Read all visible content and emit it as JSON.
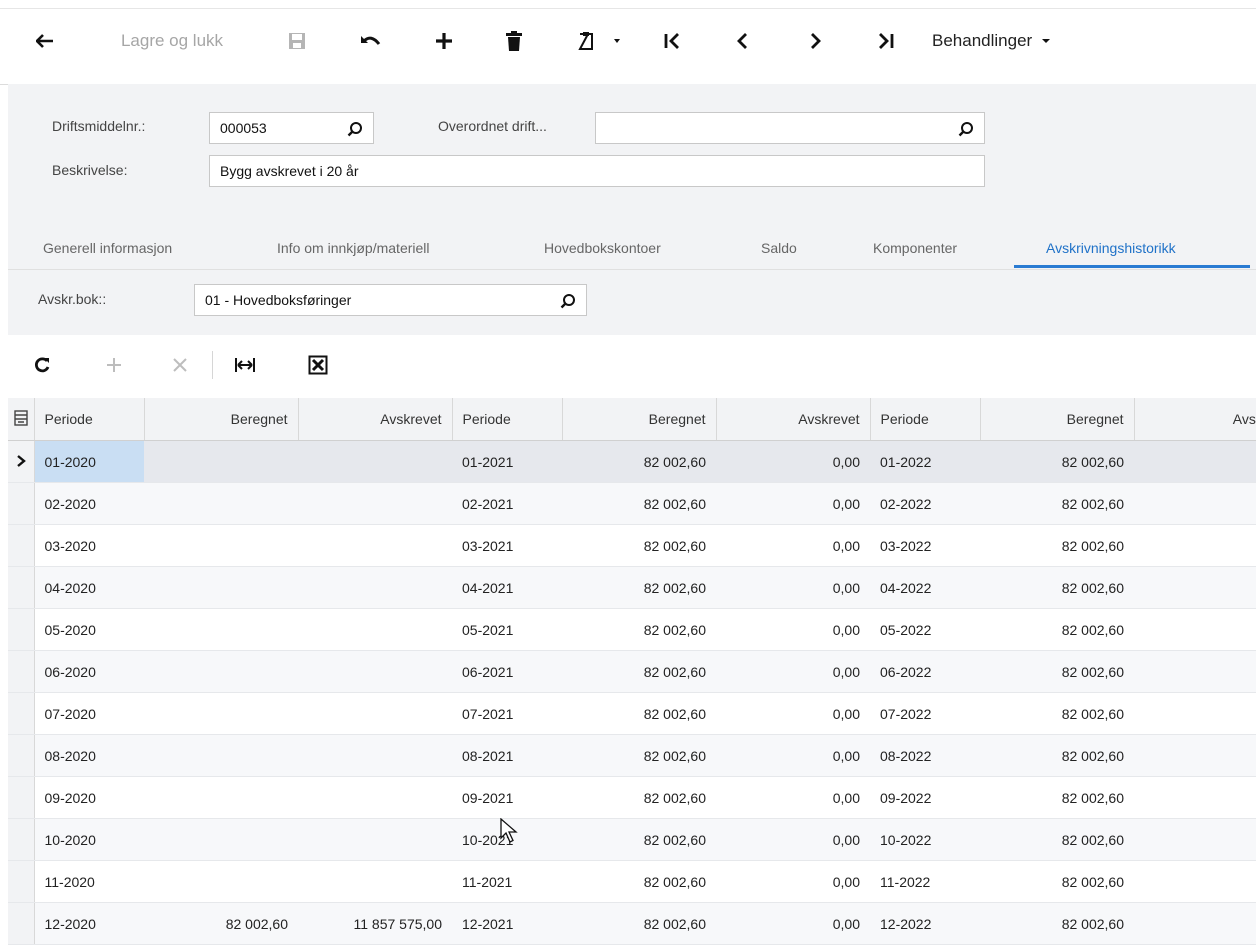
{
  "toolbar": {
    "back_icon": "arrow-left-icon",
    "save_close_label": "Lagre og lukk",
    "save_icon": "floppy-disk-icon",
    "undo_icon": "undo-icon",
    "add_icon": "plus-icon",
    "delete_icon": "trash-icon",
    "clipboard_icon": "clipboard-dropdown-icon",
    "first_icon": "first-record-icon",
    "prev_icon": "previous-record-icon",
    "next_icon": "next-record-icon",
    "last_icon": "last-record-icon",
    "actions_label": "Behandlinger"
  },
  "form": {
    "asset_no_label": "Driftsmiddelnr.:",
    "asset_no_value": "000053",
    "parent_label": "Overordnet drift...",
    "parent_value": "",
    "description_label": "Beskrivelse:",
    "description_value": "Bygg avskrevet i 20 år"
  },
  "tabs": [
    {
      "label": "Generell informasjon",
      "active": false
    },
    {
      "label": "Info om innkjøp/materiell",
      "active": false
    },
    {
      "label": "Hovedbokskontoer",
      "active": false
    },
    {
      "label": "Saldo",
      "active": false
    },
    {
      "label": "Komponenter",
      "active": false
    },
    {
      "label": "Avskrivningshistorikk",
      "active": true
    }
  ],
  "book": {
    "label": "Avskr.bok::",
    "value": "01 - Hovedboksføringer"
  },
  "grid_toolbar": {
    "refresh_icon": "refresh-icon",
    "add_icon": "plus-icon",
    "remove_icon": "close-icon",
    "fit_icon": "fit-columns-icon",
    "export_icon": "excel-export-icon"
  },
  "grid": {
    "columns": [
      "Periode",
      "Beregnet",
      "Avskrevet",
      "Periode",
      "Beregnet",
      "Avskrevet",
      "Periode",
      "Beregnet",
      "Avskr"
    ],
    "rows": [
      [
        "01-2020",
        "",
        "",
        "01-2021",
        "82 002,60",
        "0,00",
        "01-2022",
        "82 002,60",
        "("
      ],
      [
        "02-2020",
        "",
        "",
        "02-2021",
        "82 002,60",
        "0,00",
        "02-2022",
        "82 002,60",
        "("
      ],
      [
        "03-2020",
        "",
        "",
        "03-2021",
        "82 002,60",
        "0,00",
        "03-2022",
        "82 002,60",
        "("
      ],
      [
        "04-2020",
        "",
        "",
        "04-2021",
        "82 002,60",
        "0,00",
        "04-2022",
        "82 002,60",
        "("
      ],
      [
        "05-2020",
        "",
        "",
        "05-2021",
        "82 002,60",
        "0,00",
        "05-2022",
        "82 002,60",
        "("
      ],
      [
        "06-2020",
        "",
        "",
        "06-2021",
        "82 002,60",
        "0,00",
        "06-2022",
        "82 002,60",
        "("
      ],
      [
        "07-2020",
        "",
        "",
        "07-2021",
        "82 002,60",
        "0,00",
        "07-2022",
        "82 002,60",
        "("
      ],
      [
        "08-2020",
        "",
        "",
        "08-2021",
        "82 002,60",
        "0,00",
        "08-2022",
        "82 002,60",
        "("
      ],
      [
        "09-2020",
        "",
        "",
        "09-2021",
        "82 002,60",
        "0,00",
        "09-2022",
        "82 002,60",
        "("
      ],
      [
        "10-2020",
        "",
        "",
        "10-2021",
        "82 002,60",
        "0,00",
        "10-2022",
        "82 002,60",
        "("
      ],
      [
        "11-2020",
        "",
        "",
        "11-2021",
        "82 002,60",
        "0,00",
        "11-2022",
        "82 002,60",
        "("
      ],
      [
        "12-2020",
        "82 002,60",
        "11 857 575,00",
        "12-2021",
        "82 002,60",
        "0,00",
        "12-2022",
        "82 002,60",
        "("
      ]
    ]
  }
}
